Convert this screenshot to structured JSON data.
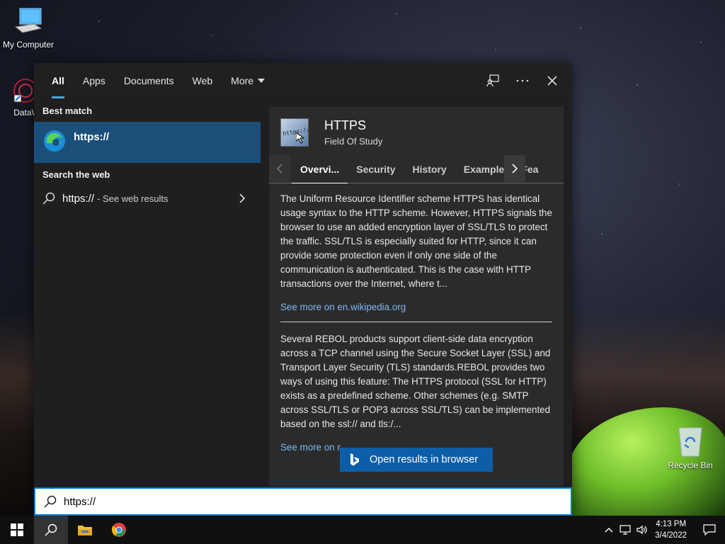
{
  "desktop": {
    "icons": [
      {
        "label": "My Computer"
      },
      {
        "label": "DataWag"
      },
      {
        "label": "Recycle Bin"
      }
    ]
  },
  "search": {
    "tabs": [
      "All",
      "Apps",
      "Documents",
      "Web",
      "More"
    ],
    "active_tab": "All",
    "best_match_title": "Best match",
    "best_match_name": "https://",
    "search_web_title": "Search the web",
    "web_query": "https://",
    "web_hint": "- See web results",
    "query_value": "https://",
    "open_button_label": "Open results in browser"
  },
  "entity": {
    "title": "HTTPS",
    "subtitle": "Field Of Study",
    "tabs": [
      "Overvi...",
      "Security",
      "History",
      "Example",
      "Fea"
    ],
    "active_tab": "Overvi...",
    "paragraph1": "The Uniform Resource Identifier scheme HTTPS has identical usage syntax to the HTTP scheme. However, HTTPS signals the browser to use an added encryption layer of SSL/TLS to protect the traffic. SSL/TLS is especially suited for HTTP, since it can provide some protection even if only one side of the communication is authenticated. This is the case with HTTP transactions over the Internet, where t...",
    "link1": "See more on en.wikipedia.org",
    "paragraph2": "Several REBOL products support client-side data encryption across a TCP channel using the Secure Socket Layer (SSL) and Transport Layer Security (TLS) standards.REBOL provides two ways of using this feature: The HTTPS protocol (SSL for HTTP) exists as a predefined scheme. Other schemes (e.g. SMTP across SSL/TLS or POP3 across SSL/TLS) can be implemented based on the ssl:// and tls:/...",
    "link2": "See more on r",
    "thumb_text": "https://www"
  },
  "taskbar": {
    "time": "4:13 PM",
    "date": "3/4/2022"
  },
  "colors": {
    "accent": "#0078d7",
    "best_match_bg": "#1b4f7a",
    "link": "#7fb8f0"
  }
}
